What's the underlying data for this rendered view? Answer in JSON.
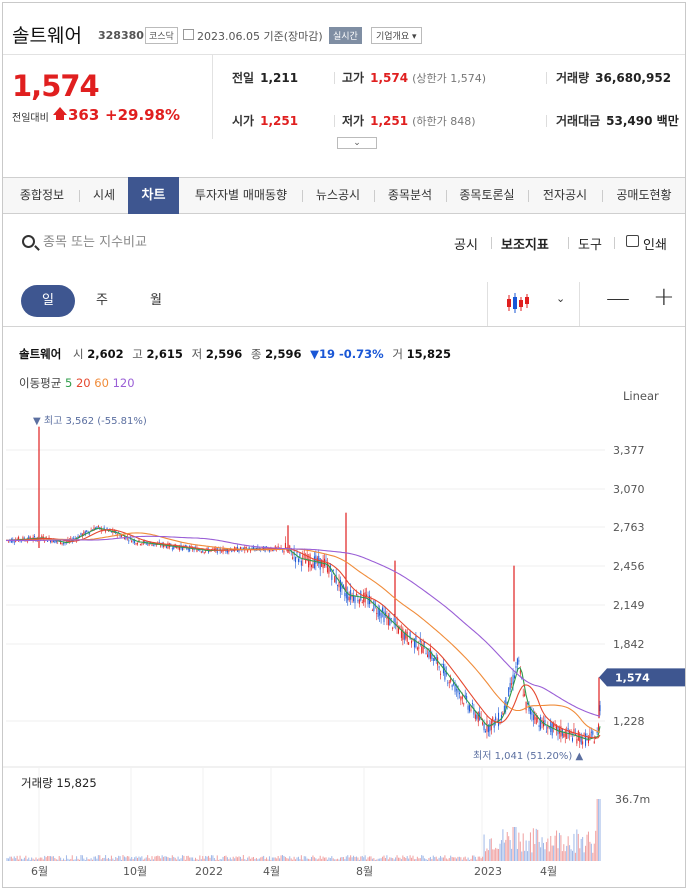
{
  "header": {
    "name": "솔트웨어",
    "code": "328380",
    "market": "코스닥",
    "date": "2023.06.05",
    "basis": "기준(장마감)",
    "realtime": "실시간",
    "corp_info": "기업개요"
  },
  "price": {
    "current": "1,574",
    "change_label": "전일대비",
    "change": "363",
    "change_pct": "+29.98%",
    "direction": "up",
    "up_color": "#e01f1f",
    "down_color": "#1a57d6"
  },
  "stats": {
    "prev_label": "전일",
    "prev": "1,211",
    "high_label": "고가",
    "high": "1,574",
    "high_limit": "(상한가 1,574)",
    "volume_label": "거래량",
    "volume": "36,680,952",
    "open_label": "시가",
    "open": "1,251",
    "low_label": "저가",
    "low": "1,251",
    "low_limit": "(하한가 848)",
    "amount_label": "거래대금",
    "amount": "53,490 백만"
  },
  "tabs": [
    {
      "label": "종합정보",
      "active": false
    },
    {
      "label": "시세",
      "active": false
    },
    {
      "label": "차트",
      "active": true
    },
    {
      "label": "투자자별 매매동향",
      "active": false
    },
    {
      "label": "뉴스공시",
      "active": false
    },
    {
      "label": "종목분석",
      "active": false
    },
    {
      "label": "종목토론실",
      "active": false
    },
    {
      "label": "전자공시",
      "active": false
    },
    {
      "label": "공매도현황",
      "active": false
    }
  ],
  "toolbar": {
    "search_placeholder": "종목 또는 지수비교",
    "notice": "공시",
    "indicator": "보조지표",
    "tools": "도구",
    "print": "인쇄"
  },
  "period": {
    "day": "일",
    "week": "주",
    "month": "월",
    "active": "day"
  },
  "chart_legend": {
    "stock": "솔트웨어",
    "open_label": "시",
    "open": "2,602",
    "high_label": "고",
    "high": "2,615",
    "low_label": "저",
    "low": "2,596",
    "close_label": "종",
    "close": "2,596",
    "change": "▼19 -0.73%",
    "vol_label": "거",
    "vol": "15,825",
    "ma_label": "이동평균",
    "ma": [
      {
        "label": "5",
        "color": "#2e9c4a"
      },
      {
        "label": "20",
        "color": "#e5482f"
      },
      {
        "label": "60",
        "color": "#f08c3a"
      },
      {
        "label": "120",
        "color": "#9a5fd6"
      }
    ],
    "scale": "Linear"
  },
  "chart_data": {
    "type": "candlestick",
    "y_ticks": [
      "3,377",
      "3,070",
      "2,763",
      "2,456",
      "2,149",
      "1,842",
      "1,228"
    ],
    "x_ticks": [
      "6월",
      "10월",
      "2022",
      "4월",
      "8월",
      "2023",
      "4월"
    ],
    "ylim": [
      950,
      3700
    ],
    "current_price_label": "1,574",
    "max_label": "▼ 최고 3,562 (-55.81%)",
    "min_label": "최저 1,041 (51.20%) ▲",
    "volume_label": "거래량 15,825",
    "volume_axis_label": "36.7m",
    "close_series_key": [
      [
        "6월",
        2660
      ],
      [
        "10월",
        2740
      ],
      [
        "2022",
        2570
      ],
      [
        "4월",
        2590
      ],
      [
        "8월",
        2300
      ],
      [
        "2023",
        1200
      ],
      [
        "4월",
        1130
      ],
      [
        "last",
        1574
      ]
    ]
  }
}
